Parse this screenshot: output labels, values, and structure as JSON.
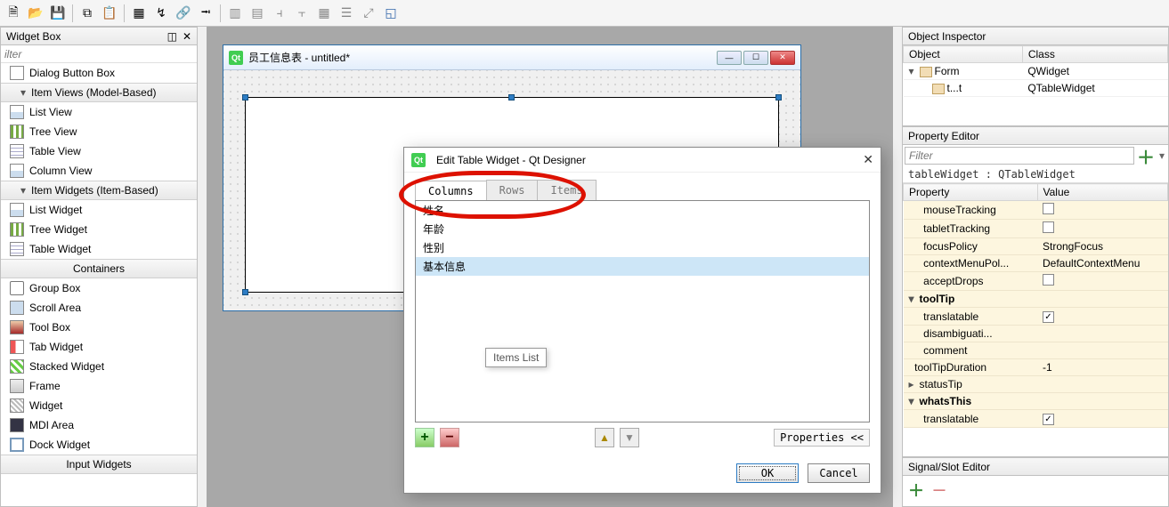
{
  "toolbar": {
    "icons": [
      "new",
      "open",
      "save",
      "|",
      "copy",
      "paste",
      "|",
      "select",
      "drag",
      "adjust",
      "tab",
      "widget",
      "|",
      "hlayout",
      "vlayout",
      "hsplit",
      "vsplit",
      "grid",
      "form",
      "break",
      "adjust2"
    ]
  },
  "widgetBox": {
    "title": "Widget Box",
    "filterPlaceholder": "ilter",
    "items": [
      {
        "type": "item",
        "icon": "dbb",
        "label": "Dialog Button Box"
      },
      {
        "type": "cat",
        "label": "Item Views (Model-Based)",
        "align": "left",
        "expand": "v"
      },
      {
        "type": "item",
        "icon": "view",
        "label": "List View"
      },
      {
        "type": "item",
        "icon": "tree",
        "label": "Tree View"
      },
      {
        "type": "item",
        "icon": "table",
        "label": "Table View"
      },
      {
        "type": "item",
        "icon": "view",
        "label": "Column View"
      },
      {
        "type": "cat",
        "label": "Item Widgets (Item-Based)",
        "align": "left",
        "expand": "v"
      },
      {
        "type": "item",
        "icon": "view",
        "label": "List Widget"
      },
      {
        "type": "item",
        "icon": "tree",
        "label": "Tree Widget"
      },
      {
        "type": "item",
        "icon": "table",
        "label": "Table Widget"
      },
      {
        "type": "cat",
        "label": "Containers",
        "align": "center"
      },
      {
        "type": "item",
        "icon": "grp",
        "label": "Group Box"
      },
      {
        "type": "item",
        "icon": "scroll",
        "label": "Scroll Area"
      },
      {
        "type": "item",
        "icon": "toolbox",
        "label": "Tool Box"
      },
      {
        "type": "item",
        "icon": "tab",
        "label": "Tab Widget"
      },
      {
        "type": "item",
        "icon": "stack",
        "label": "Stacked Widget"
      },
      {
        "type": "item",
        "icon": "frame",
        "label": "Frame"
      },
      {
        "type": "item",
        "icon": "widget",
        "label": "Widget"
      },
      {
        "type": "item",
        "icon": "mdi",
        "label": "MDI Area"
      },
      {
        "type": "item",
        "icon": "dock",
        "label": "Dock Widget"
      },
      {
        "type": "cat",
        "label": "Input Widgets",
        "align": "center"
      }
    ]
  },
  "formWindow": {
    "title": "员工信息表 - untitled*"
  },
  "dialog": {
    "title": "Edit Table Widget - Qt Designer",
    "tabs": [
      "Columns",
      "Rows",
      "Items"
    ],
    "activeTab": 0,
    "listItems": [
      "姓名",
      "年龄",
      "性别",
      "基本信息"
    ],
    "selected": 3,
    "tooltip": "Items List",
    "propLink": "Properties <<",
    "ok": "OK",
    "cancel": "Cancel"
  },
  "objectInspector": {
    "title": "Object Inspector",
    "headers": [
      "Object",
      "Class"
    ],
    "rows": [
      {
        "indent": 0,
        "toggle": "v",
        "icon": "form",
        "obj": "Form",
        "cls": "QWidget"
      },
      {
        "indent": 1,
        "toggle": "",
        "icon": "tbl",
        "obj": "t...t",
        "cls": "QTableWidget"
      }
    ]
  },
  "propertyEditor": {
    "title": "Property Editor",
    "filterPlaceholder": "Filter",
    "context": "tableWidget : QTableWidget",
    "headers": [
      "Property",
      "Value"
    ],
    "rows": [
      {
        "k": "mouseTracking",
        "v": "",
        "cb": true,
        "chk": false,
        "ind": 1
      },
      {
        "k": "tabletTracking",
        "v": "",
        "cb": true,
        "chk": false,
        "ind": 1
      },
      {
        "k": "focusPolicy",
        "v": "StrongFocus",
        "ind": 1
      },
      {
        "k": "contextMenuPol...",
        "v": "DefaultContextMenu",
        "ind": 1
      },
      {
        "k": "acceptDrops",
        "v": "",
        "cb": true,
        "chk": false,
        "ind": 1
      },
      {
        "k": "toolTip",
        "v": "",
        "expand": "v",
        "bold": true,
        "ind": 0
      },
      {
        "k": "translatable",
        "v": "",
        "cb": true,
        "chk": true,
        "ind": 1
      },
      {
        "k": "disambiguati...",
        "v": "",
        "ind": 1
      },
      {
        "k": "comment",
        "v": "",
        "ind": 1
      },
      {
        "k": "toolTipDuration",
        "v": "-1",
        "ind": 0
      },
      {
        "k": "statusTip",
        "v": "",
        "expand": ">",
        "ind": 0
      },
      {
        "k": "whatsThis",
        "v": "",
        "expand": "v",
        "bold": true,
        "ind": 0
      },
      {
        "k": "translatable",
        "v": "",
        "cb": true,
        "chk": true,
        "ind": 1
      }
    ]
  },
  "signalSlot": {
    "title": "Signal/Slot Editor"
  }
}
